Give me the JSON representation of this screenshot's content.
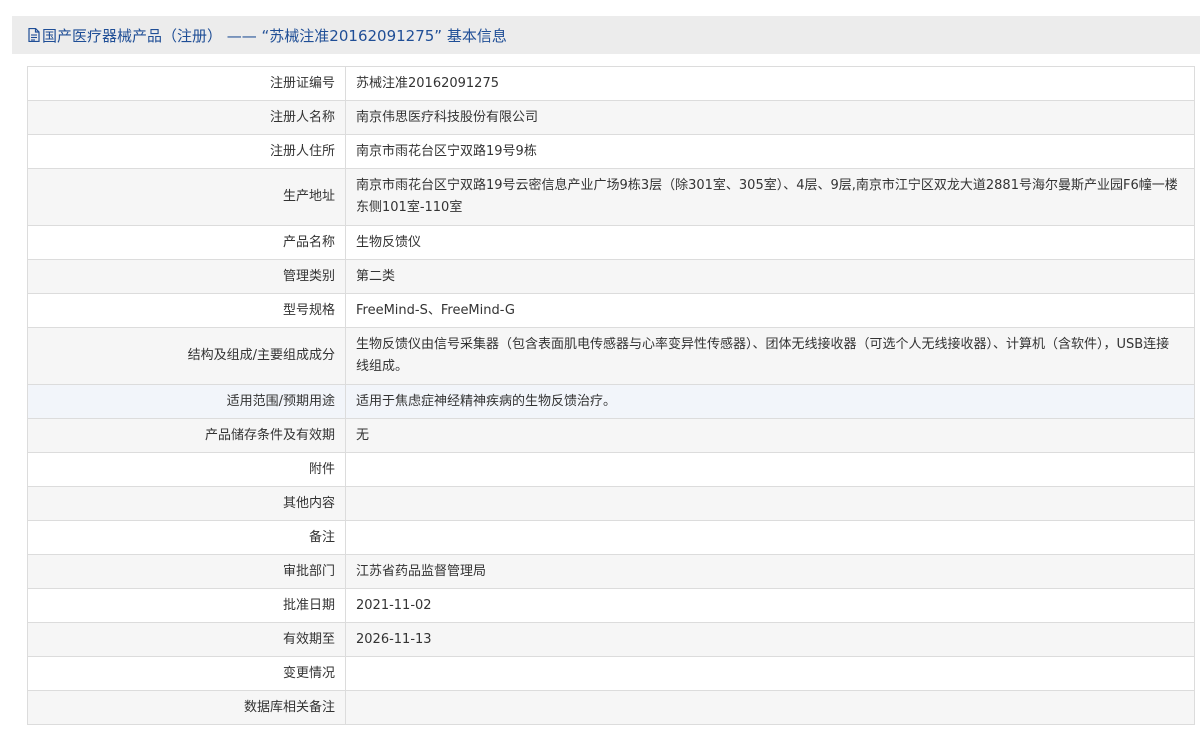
{
  "header": {
    "title": "国产医疗器械产品（注册） —— “苏械注准20162091275” 基本信息"
  },
  "rows": [
    {
      "label": "注册证编号",
      "value": "苏械注准20162091275"
    },
    {
      "label": "注册人名称",
      "value": "南京伟思医疗科技股份有限公司"
    },
    {
      "label": "注册人住所",
      "value": "南京市雨花台区宁双路19号9栋"
    },
    {
      "label": "生产地址",
      "value": "南京市雨花台区宁双路19号云密信息产业广场9栋3层（除301室、305室）、4层、9层,南京市江宁区双龙大道2881号海尔曼斯产业园F6幢一楼东侧101室-110室"
    },
    {
      "label": "产品名称",
      "value": "生物反馈仪"
    },
    {
      "label": "管理类别",
      "value": "第二类"
    },
    {
      "label": "型号规格",
      "value": "FreeMind-S、FreeMind-G"
    },
    {
      "label": "结构及组成/主要组成成分",
      "value": "生物反馈仪由信号采集器（包含表面肌电传感器与心率变异性传感器）、团体无线接收器（可选个人无线接收器）、计算机（含软件），USB连接线组成。"
    },
    {
      "label": "适用范围/预期用途",
      "value": "适用于焦虑症神经精神疾病的生物反馈治疗。"
    },
    {
      "label": "产品储存条件及有效期",
      "value": "无"
    },
    {
      "label": "附件",
      "value": ""
    },
    {
      "label": "其他内容",
      "value": ""
    },
    {
      "label": "备注",
      "value": ""
    },
    {
      "label": "审批部门",
      "value": "江苏省药品监督管理局"
    },
    {
      "label": "批准日期",
      "value": "2021-11-02"
    },
    {
      "label": "有效期至",
      "value": "2026-11-13"
    },
    {
      "label": "变更情况",
      "value": ""
    },
    {
      "label": "数据库相关备注",
      "value": ""
    }
  ]
}
